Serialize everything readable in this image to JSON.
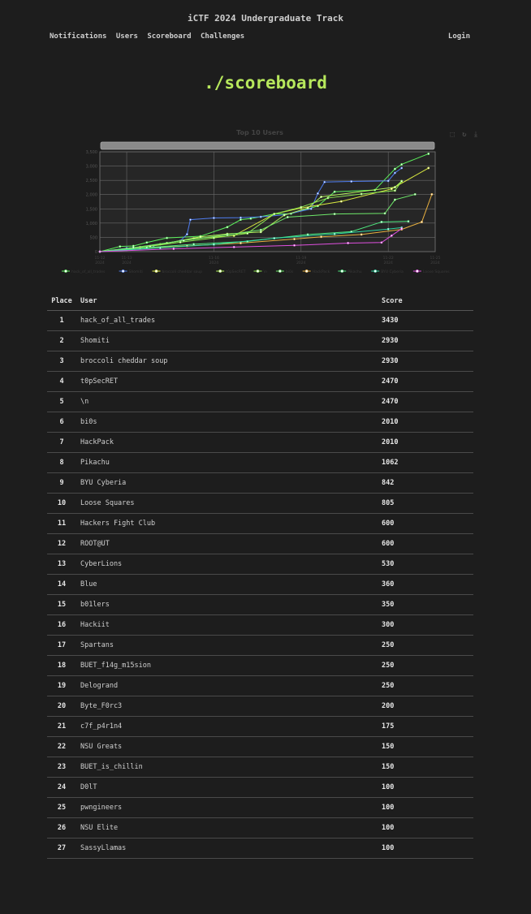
{
  "site_title": "iCTF 2024 Undergraduate Track",
  "nav": {
    "items": [
      "Notifications",
      "Users",
      "Scoreboard",
      "Challenges"
    ],
    "login": "Login"
  },
  "page_title": "./scoreboard",
  "chart_toolbox": [
    "zoom-icon",
    "restore-icon",
    "download-icon"
  ],
  "chart_data": {
    "type": "line",
    "title": "Top 10 Users",
    "ylim": [
      0,
      3500
    ],
    "y_ticks": [
      "3,500",
      "3,000",
      "2,500",
      "2,000",
      "1,500",
      "1,000",
      "500",
      "0"
    ],
    "x_ticks": [
      "11-12\n2024",
      "11-13\n2024",
      "11-16\n2024",
      "11-19\n2024",
      "11-22\n2024",
      "11-25\n2024"
    ],
    "legend_position": "bottom",
    "series": [
      {
        "name": "hack_of_all_trades",
        "color": "#5cf15c",
        "values": [
          [
            0,
            0
          ],
          [
            6,
            180
          ],
          [
            10,
            200
          ],
          [
            14,
            320
          ],
          [
            20,
            480
          ],
          [
            30,
            540
          ],
          [
            38,
            860
          ],
          [
            42,
            1120
          ],
          [
            45,
            1160
          ],
          [
            52,
            1320
          ],
          [
            57,
            1330
          ],
          [
            65,
            1600
          ],
          [
            70,
            2100
          ],
          [
            82,
            2160
          ],
          [
            88,
            2900
          ],
          [
            90,
            3060
          ],
          [
            98,
            3430
          ]
        ]
      },
      {
        "name": "Shomiti",
        "color": "#4f7df0",
        "values": [
          [
            0,
            0
          ],
          [
            8,
            120
          ],
          [
            16,
            210
          ],
          [
            24,
            380
          ],
          [
            26,
            610
          ],
          [
            27,
            1120
          ],
          [
            34,
            1180
          ],
          [
            42,
            1190
          ],
          [
            48,
            1220
          ],
          [
            55,
            1290
          ],
          [
            63,
            1500
          ],
          [
            65,
            2040
          ],
          [
            67,
            2440
          ],
          [
            75,
            2460
          ],
          [
            86,
            2480
          ],
          [
            88,
            2760
          ],
          [
            90,
            2930
          ]
        ]
      },
      {
        "name": "broccoli cheddar soup",
        "color": "#d8e840",
        "values": [
          [
            0,
            0
          ],
          [
            9,
            110
          ],
          [
            18,
            260
          ],
          [
            28,
            460
          ],
          [
            40,
            560
          ],
          [
            52,
            1320
          ],
          [
            60,
            1530
          ],
          [
            72,
            1760
          ],
          [
            87,
            2200
          ],
          [
            98,
            2930
          ]
        ]
      },
      {
        "name": "t0pSecRET",
        "color": "#b5f55e",
        "values": [
          [
            0,
            0
          ],
          [
            12,
            160
          ],
          [
            20,
            300
          ],
          [
            30,
            520
          ],
          [
            38,
            620
          ],
          [
            48,
            690
          ],
          [
            55,
            1280
          ],
          [
            62,
            1530
          ],
          [
            66,
            1920
          ],
          [
            88,
            2260
          ],
          [
            90,
            2470
          ]
        ]
      },
      {
        "name": "\\n",
        "color": "#8de850",
        "values": [
          [
            0,
            0
          ],
          [
            15,
            190
          ],
          [
            24,
            330
          ],
          [
            34,
            480
          ],
          [
            44,
            640
          ],
          [
            52,
            1320
          ],
          [
            60,
            1560
          ],
          [
            68,
            1880
          ],
          [
            78,
            2020
          ],
          [
            88,
            2140
          ],
          [
            90,
            2470
          ]
        ]
      },
      {
        "name": "bi0s",
        "color": "#6ee86a",
        "values": [
          [
            0,
            0
          ],
          [
            10,
            140
          ],
          [
            25,
            390
          ],
          [
            38,
            590
          ],
          [
            48,
            760
          ],
          [
            56,
            1210
          ],
          [
            70,
            1320
          ],
          [
            85,
            1340
          ],
          [
            88,
            1820
          ],
          [
            94,
            2010
          ]
        ]
      },
      {
        "name": "HackPack",
        "color": "#e8b040",
        "values": [
          [
            0,
            0
          ],
          [
            12,
            120
          ],
          [
            26,
            200
          ],
          [
            42,
            300
          ],
          [
            58,
            440
          ],
          [
            66,
            520
          ],
          [
            78,
            600
          ],
          [
            90,
            780
          ],
          [
            96,
            1040
          ],
          [
            99,
            2010
          ]
        ]
      },
      {
        "name": "Pikachu",
        "color": "#4fea80",
        "values": [
          [
            0,
            0
          ],
          [
            14,
            140
          ],
          [
            28,
            260
          ],
          [
            44,
            360
          ],
          [
            62,
            600
          ],
          [
            75,
            700
          ],
          [
            84,
            1040
          ],
          [
            92,
            1062
          ]
        ]
      },
      {
        "name": "BYU Cyberia",
        "color": "#2fd6a0",
        "values": [
          [
            0,
            0
          ],
          [
            18,
            130
          ],
          [
            34,
            250
          ],
          [
            52,
            470
          ],
          [
            70,
            620
          ],
          [
            86,
            790
          ],
          [
            90,
            842
          ]
        ]
      },
      {
        "name": "Loose Squares",
        "color": "#e050e0",
        "values": [
          [
            0,
            0
          ],
          [
            22,
            100
          ],
          [
            40,
            160
          ],
          [
            58,
            220
          ],
          [
            74,
            300
          ],
          [
            84,
            320
          ],
          [
            87,
            560
          ],
          [
            90,
            805
          ]
        ]
      }
    ]
  },
  "table": {
    "headers": {
      "place": "Place",
      "user": "User",
      "score": "Score"
    },
    "rows": [
      {
        "place": "1",
        "user": "hack_of_all_trades",
        "score": "3430"
      },
      {
        "place": "2",
        "user": "Shomiti",
        "score": "2930"
      },
      {
        "place": "3",
        "user": "broccoli cheddar soup",
        "score": "2930"
      },
      {
        "place": "4",
        "user": "t0pSecRET",
        "score": "2470"
      },
      {
        "place": "5",
        "user": "\\n",
        "score": "2470"
      },
      {
        "place": "6",
        "user": "bi0s",
        "score": "2010"
      },
      {
        "place": "7",
        "user": "HackPack",
        "score": "2010"
      },
      {
        "place": "8",
        "user": "Pikachu",
        "score": "1062"
      },
      {
        "place": "9",
        "user": "BYU Cyberia",
        "score": "842"
      },
      {
        "place": "10",
        "user": "Loose Squares",
        "score": "805"
      },
      {
        "place": "11",
        "user": "Hackers Fight Club",
        "score": "600"
      },
      {
        "place": "12",
        "user": "ROOT@UT",
        "score": "600"
      },
      {
        "place": "13",
        "user": "CyberLions",
        "score": "530"
      },
      {
        "place": "14",
        "user": "Blue",
        "score": "360"
      },
      {
        "place": "15",
        "user": "b01lers",
        "score": "350"
      },
      {
        "place": "16",
        "user": "Hackiit",
        "score": "300"
      },
      {
        "place": "17",
        "user": "Spartans",
        "score": "250"
      },
      {
        "place": "18",
        "user": "BUET_f14g_m15sion",
        "score": "250"
      },
      {
        "place": "19",
        "user": "Delogrand",
        "score": "250"
      },
      {
        "place": "20",
        "user": "Byte_F0rc3",
        "score": "200"
      },
      {
        "place": "21",
        "user": "c7f_p4r1n4",
        "score": "175"
      },
      {
        "place": "22",
        "user": "NSU Greats",
        "score": "150"
      },
      {
        "place": "23",
        "user": "BUET_is_chillin",
        "score": "150"
      },
      {
        "place": "24",
        "user": "D0lT",
        "score": "100"
      },
      {
        "place": "25",
        "user": "pwngineers",
        "score": "100"
      },
      {
        "place": "26",
        "user": "NSU Elite",
        "score": "100"
      },
      {
        "place": "27",
        "user": "SassyLlamas",
        "score": "100"
      }
    ]
  }
}
